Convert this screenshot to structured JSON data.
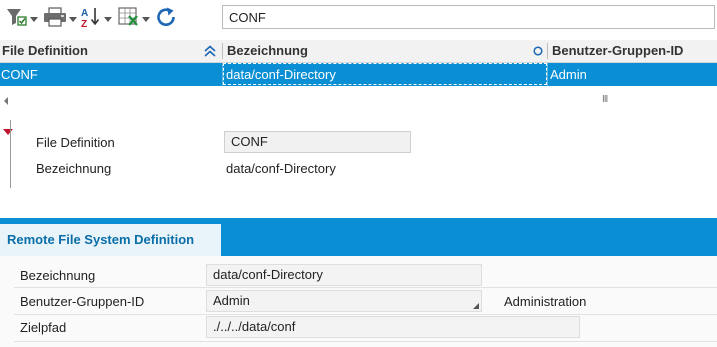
{
  "toolbar": {
    "buttons": [
      {
        "name": "filter-button",
        "icon": "filter-icon"
      },
      {
        "name": "print-button",
        "icon": "printer-icon"
      },
      {
        "name": "sort-button",
        "icon": "sort-az-icon"
      },
      {
        "name": "export-button",
        "icon": "export-excel-icon"
      },
      {
        "name": "refresh-button",
        "icon": "refresh-icon"
      }
    ],
    "search_value": "CONF"
  },
  "grid": {
    "columns": [
      "File Definition",
      "Bezeichnung",
      "Benutzer-Gruppen-ID"
    ],
    "rows": [
      {
        "file_definition": "CONF",
        "bezeichnung": "data/conf-Directory",
        "gruppe": "Admin"
      }
    ],
    "scroll_marker": "III"
  },
  "detail": {
    "file_definition_label": "File Definition",
    "file_definition_value": "CONF",
    "bezeichnung_label": "Bezeichnung",
    "bezeichnung_value": "data/conf-Directory"
  },
  "tab": {
    "title": "Remote File System Definition",
    "fields": {
      "bezeichnung_label": "Bezeichnung",
      "bezeichnung_value": "data/conf-Directory",
      "gruppe_label": "Benutzer-Gruppen-ID",
      "gruppe_value": "Admin",
      "gruppe_description": "Administration",
      "zielpfad_label": "Zielpfad",
      "zielpfad_value": "./../../data/conf"
    }
  },
  "colors": {
    "accent": "#0a8fd4",
    "marker_red": "#c0152b"
  }
}
